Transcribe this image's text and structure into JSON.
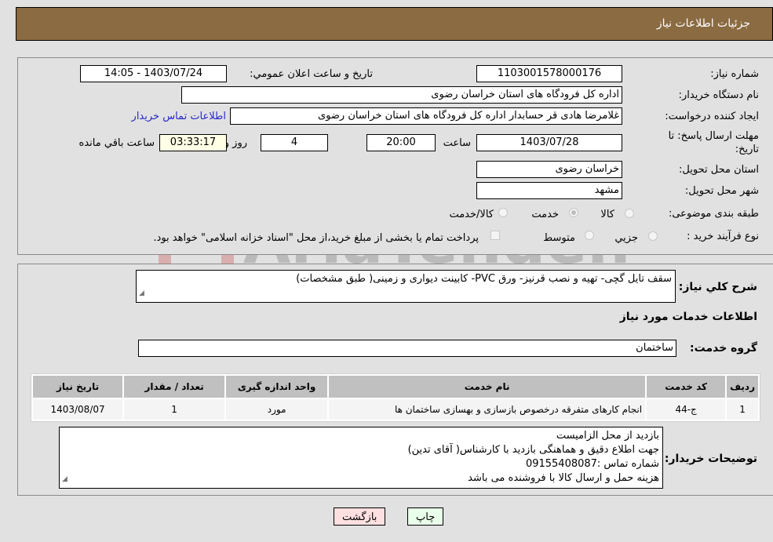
{
  "header": {
    "title": "جزئیات اطلاعات نیاز"
  },
  "form": {
    "need_number": {
      "label": "شماره نیاز:",
      "value": "1103001578000176"
    },
    "announce_datetime": {
      "label": "تاریخ و ساعت اعلان عمومي:",
      "value": "1403/07/24 - 14:05"
    },
    "buyer_org": {
      "label": "نام دستگاه خریدار:",
      "value": "اداره کل فرودگاه های استان خراسان رضوی"
    },
    "requester": {
      "label": "ایجاد کننده درخواست:",
      "value": "غلامرضا هادی قر حسابدار اداره کل فرودگاه های استان خراسان رضوی"
    },
    "buyer_contact_link": "اطلاعات تماس خریدار",
    "deadline": {
      "label": "مهلت ارسال پاسخ: تا تاریخ:",
      "date": "1403/07/28",
      "time_label": "ساعت",
      "time": "20:00",
      "days": "4",
      "days_label": "روز و",
      "remaining": "03:33:17",
      "remaining_label": "ساعت باقي مانده"
    },
    "delivery_province": {
      "label": "استان محل تحویل:",
      "value": "خراسان رضوی"
    },
    "delivery_city": {
      "label": "شهر محل تحویل:",
      "value": "مشهد"
    },
    "category": {
      "label": "طبقه بندی موضوعی:",
      "options": [
        "کالا",
        "خدمت",
        "کالا/خدمت"
      ],
      "selected": "خدمت"
    },
    "purchase_process": {
      "label": "نوع فرآیند خرید :",
      "options": [
        "جزيي",
        "متوسط"
      ],
      "treasury_note": "پرداخت تمام یا بخشی از مبلغ خرید،از محل \"اسناد خزانه اسلامی\" خواهد بود."
    }
  },
  "details": {
    "description_label": "شرح كلي نياز:",
    "description": "سقف تایل گچی- تهیه و نصب قرنیز- ورق PVC- کابینت دیواری و زمینی( طبق مشخصات)",
    "services_heading": "اطلاعات خدمات مورد نیاز",
    "service_group_label": "گروه خدمت:",
    "service_group": "ساختمان",
    "table": {
      "headers": [
        "ردیف",
        "کد خدمت",
        "نام خدمت",
        "واحد اندازه گیری",
        "تعداد / مقدار",
        "تاریخ نیاز"
      ],
      "rows": [
        [
          "1",
          "ج-44",
          "انجام کارهای متفرقه درخصوص بازسازی و بهسازی ساختمان ها",
          "مورد",
          "1",
          "1403/08/07"
        ]
      ]
    },
    "buyer_notes_label": "توضیحات خریدار:",
    "buyer_notes": [
      "بازدید از محل الزامیست",
      "جهت اطلاع دقیق و هماهنگی بازدید با کارشناس( آقای تدین)",
      "شماره تماس :09155408087",
      "هزینه حمل و ارسال کالا با فروشنده می باشد"
    ]
  },
  "buttons": {
    "print": "چاپ",
    "back": "بازگشت"
  },
  "watermark": "AriaTender.net",
  "colors": {
    "header_bg": "#8b6b42",
    "print_bg": "#eaffea",
    "back_bg": "#ffe0e0",
    "link": "#2828c8"
  }
}
